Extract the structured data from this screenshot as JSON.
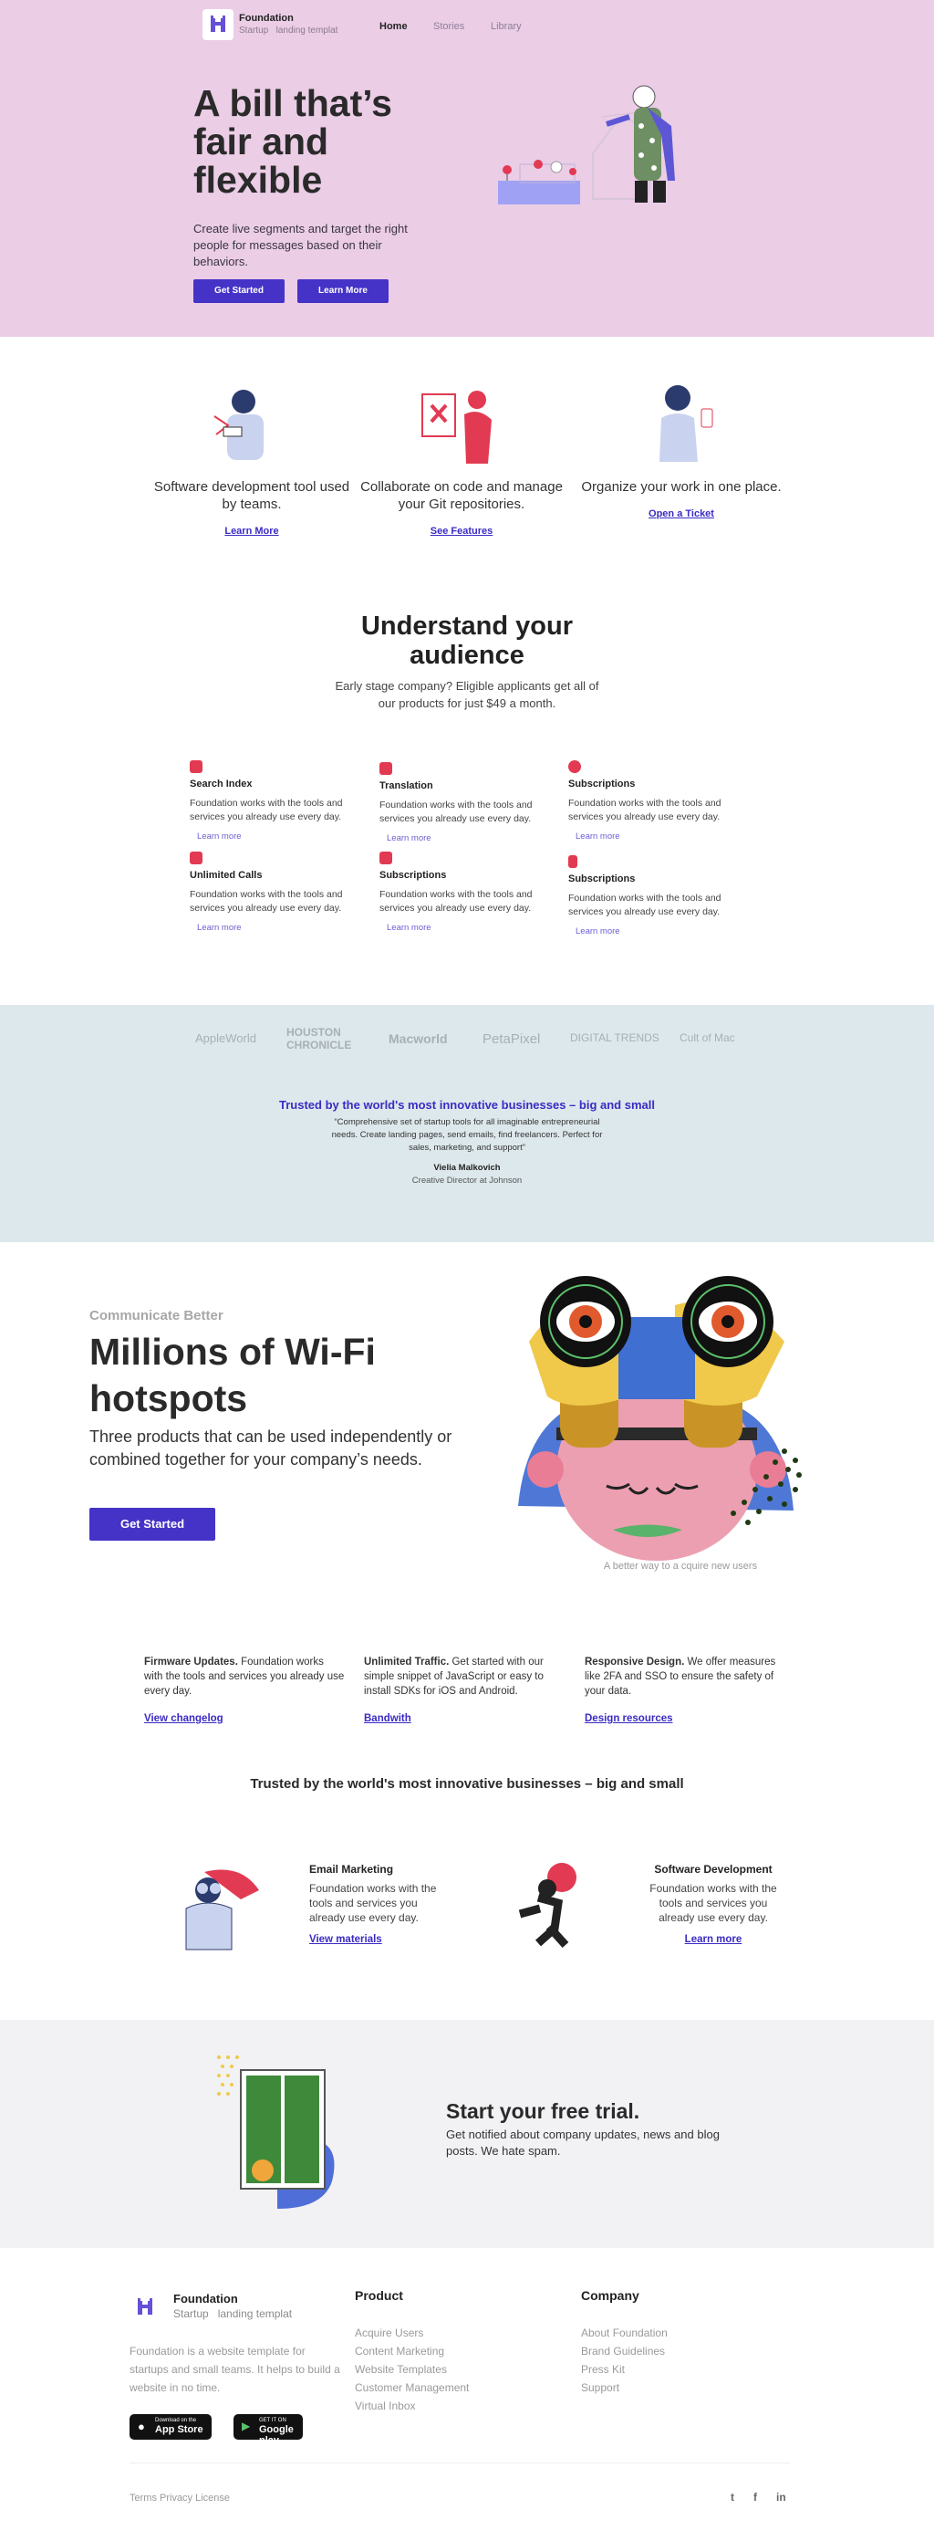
{
  "nav": {
    "brand": "Foundation",
    "tagline_a": "Startup",
    "tagline_b": "landing templat",
    "links": [
      "Home",
      "Stories",
      "Library"
    ]
  },
  "hero": {
    "title_l1": "A bill that’s",
    "title_l2": "fair and",
    "title_l3": "flexible",
    "subtitle": "Create live segments and target the right people for messages based on their behaviors.",
    "btn1": "Get Started",
    "btn2": "Learn More"
  },
  "features": [
    {
      "text": "Software development tool used by teams.",
      "link": "Learn More"
    },
    {
      "text": "Collaborate on code and manage your Git repositories.",
      "link": "See Features"
    },
    {
      "text": "Organize your work in one place.",
      "link": "Open a Ticket"
    }
  ],
  "understand": {
    "title_l1": "Understand your",
    "title_l2": "audience",
    "sub": "Early stage company? Eligible applicants get all of our products for just $49 a month."
  },
  "grid": [
    {
      "title": "Search Index",
      "text": "Foundation works with the tools and services you already use every day.",
      "link": "Learn more",
      "icon": "search-icon"
    },
    {
      "title": "Translation",
      "text": "Foundation works with the tools and services you already use every day.",
      "link": "Learn more",
      "icon": "translate-icon"
    },
    {
      "title": "Subscriptions",
      "text": "Foundation works with the tools and services you already use every day.",
      "link": "Learn more",
      "icon": "fire-icon"
    },
    {
      "title": "Unlimited Calls",
      "text": "Foundation works with the tools and services you already use every day.",
      "link": "Learn more",
      "icon": "phone-icon"
    },
    {
      "title": "Subscriptions",
      "text": "Foundation works with the tools and services you already use every day.",
      "link": "Learn more",
      "icon": "printer-icon"
    },
    {
      "title": "Subscriptions",
      "text": "Foundation works with the tools and services you already use every day.",
      "link": "Learn more",
      "icon": "signal-icon"
    }
  ],
  "brands": [
    "AppleWorld",
    "HOUSTON CHRONICLE",
    "Macworld",
    "PetaPixel",
    "DIGITAL TRENDS",
    "Cult of Mac"
  ],
  "testimonial": {
    "title": "Trusted by the world's most innovative businesses – big and small",
    "quote": "“Comprehensive set of startup tools for all imaginable entrepreneurial needs. Create landing pages, send emails, find freelancers. Perfect for sales, marketing, and support”",
    "name": "Vielia Malkovich",
    "role": "Creative Director at Johnson"
  },
  "wifi": {
    "eyebrow": "Communicate Better",
    "title_l1": "Millions of Wi-Fi",
    "title_l2": "hotspots",
    "text": "Three products that can be used independently or combined together for your company’s needs.",
    "btn": "Get Started",
    "caption": "A better way to a cquire new users"
  },
  "three": [
    {
      "bold": "Firmware Updates.",
      "text": " Foundation works with the tools and services you already use every day.",
      "link": "View changelog"
    },
    {
      "bold": "Unlimited Traffic.",
      "text": " Get started with our simple snippet of JavaScript or easy to install SDKs for iOS and Android.",
      "link": "Bandwith"
    },
    {
      "bold": "Responsive Design.",
      "text": " We offer measures like 2FA and SSO to ensure the safety of your data.",
      "link": "Design resources"
    }
  ],
  "trusted2": "Trusted by the world's most innovative businesses – big and small",
  "services": [
    {
      "title": "Email Marketing",
      "text": "Foundation works with the tools and services you already use every day.",
      "link": "View materials"
    },
    {
      "title": "Software Development",
      "text": "Foundation works with the tools and services you already use every day.",
      "link": "Learn more"
    }
  ],
  "trial": {
    "title": "Start your free trial.",
    "text": "Get notified about company updates, news and blog posts. We hate spam."
  },
  "footer": {
    "brand": "Foundation",
    "tagline_a": "Startup",
    "tagline_b": "landing templat",
    "about": "Foundation is a website template for startups and small teams. It helps to build a website in no time.",
    "product_h": "Product",
    "product": [
      "Acquire Users",
      "Content Marketing",
      "Website Templates",
      "Customer Management",
      "Virtual Inbox"
    ],
    "company_h": "Company",
    "company": [
      "About Foundation",
      "Brand Guidelines",
      "Press Kit",
      "Support"
    ],
    "appstore_small": "Download on the",
    "appstore": "App Store",
    "gplay_small": "GET IT ON",
    "gplay": "Google play",
    "legal": "Terms Privacy License"
  },
  "colors": {
    "hero_bg": "#ebcde6",
    "accent": "#4532c7",
    "trusted_bg": "#dde8ec",
    "trial_bg": "#f2f2f4"
  }
}
